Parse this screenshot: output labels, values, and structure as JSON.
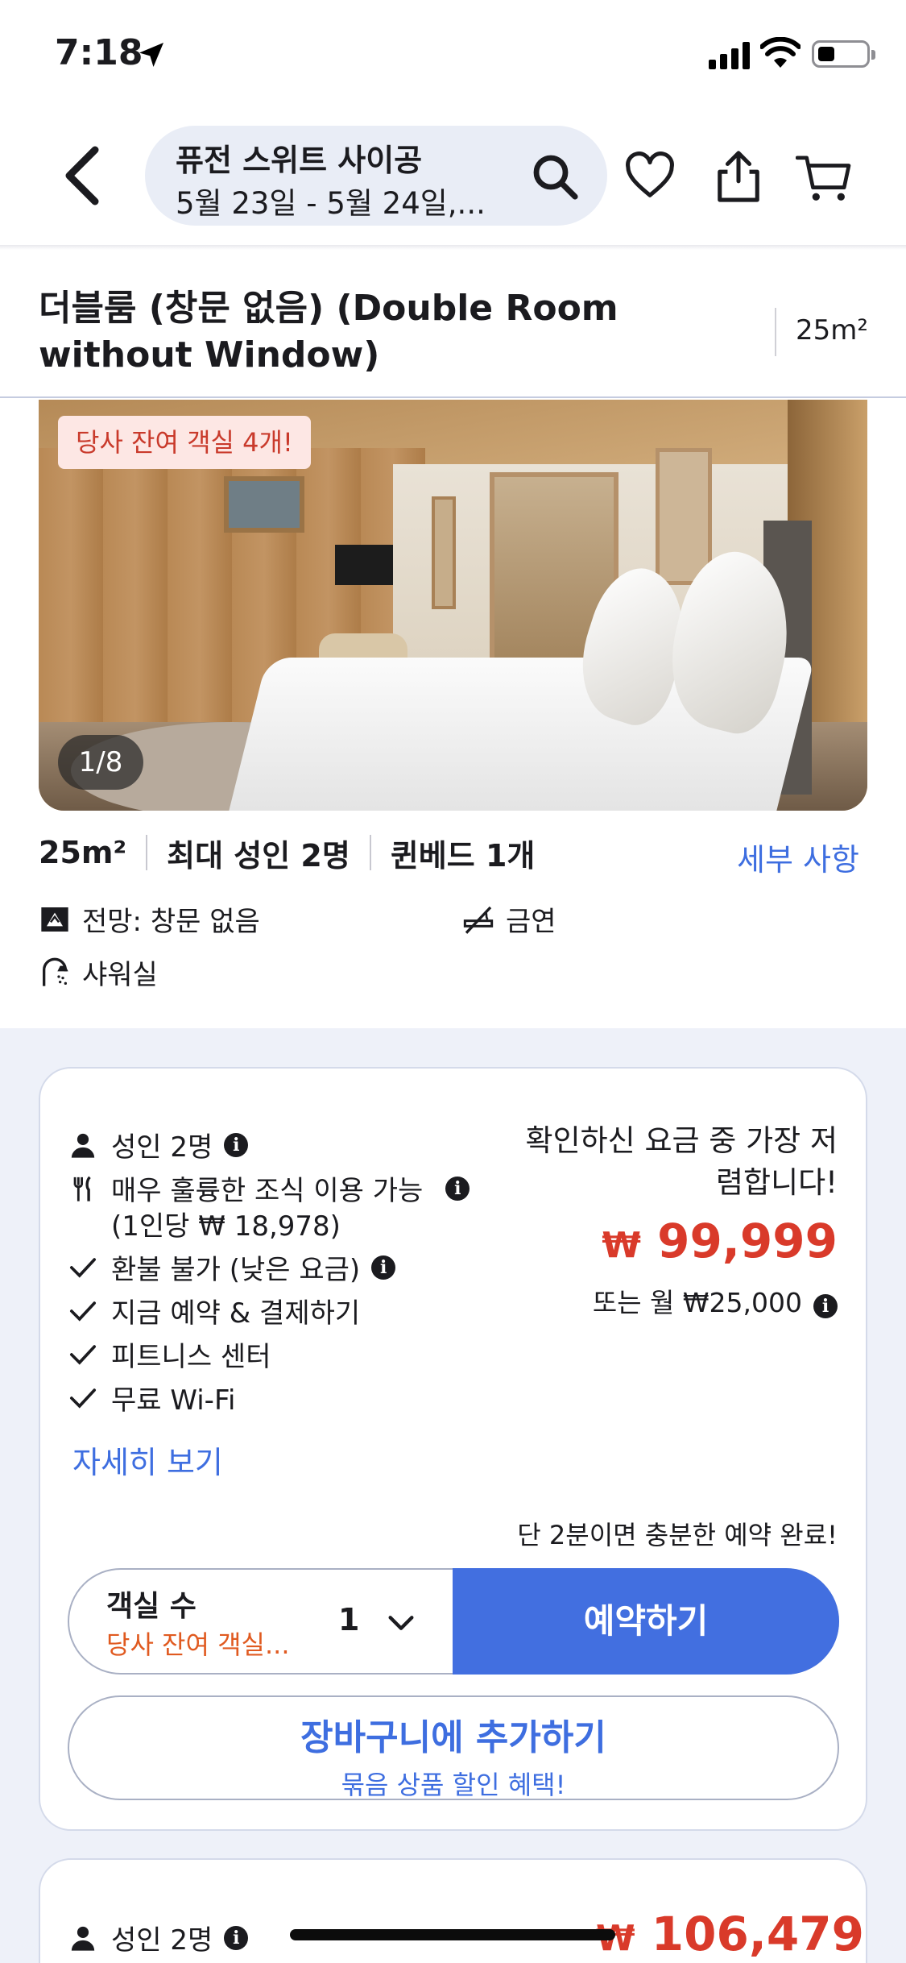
{
  "status_bar": {
    "time": "7:18"
  },
  "header": {
    "hotel_name": "퓨전 스위트 사이공",
    "dates": "5월 23일 - 5월 24일,..."
  },
  "room": {
    "title": "더블룸 (창문 없음) (Double Room without Window)",
    "size": "25m²",
    "scarcity_badge": "당사 잔여 객실 4개!",
    "photo_counter": "1/8",
    "facts": [
      "25m²",
      "최대 성인 2명",
      "퀸베드 1개"
    ],
    "details_link": "세부 사항",
    "amenities": {
      "view": "전망: 창문 없음",
      "smoking": "금연",
      "shower": "샤워실"
    }
  },
  "offer": {
    "guests": "성인 2명",
    "breakfast": "매우 훌륭한 조식 이용 가능",
    "breakfast_price": "(1인당 ₩ 18,978)",
    "refund": "환불 불가 (낮은 요금)",
    "pay_now": "지금 예약 & 결제하기",
    "fitness": "피트니스 센터",
    "wifi": "무료 Wi-Fi",
    "more_link": "자세히 보기",
    "price_note": "확인하신 요금 중 가장 저렴합니다!",
    "currency": "₩",
    "price": "99,999",
    "monthly": "또는 월 ₩25,000",
    "quick_note": "단 2분이면 충분한 예약 완료!",
    "room_count_label": "객실 수",
    "room_count_sub": "당사 잔여 객실...",
    "room_count_value": "1",
    "book_button": "예약하기",
    "cart_button": "장바구니에 추가하기",
    "cart_sub": "묶음 상품 할인 혜택!"
  },
  "offer2": {
    "guests": "성인 2명",
    "currency": "₩",
    "price": "106,479"
  },
  "colors": {
    "accent_blue": "#426fe0",
    "price_red": "#d93a2a",
    "badge_bg": "#fde7e4",
    "section_bg": "#eef1f9"
  },
  "icons": [
    "location-arrow-icon",
    "signal-icon",
    "wifi-icon",
    "battery-icon",
    "back-chevron-icon",
    "search-icon",
    "heart-icon",
    "share-icon",
    "cart-icon",
    "view-icon",
    "no-smoking-icon",
    "shower-icon",
    "person-icon",
    "fork-knife-icon",
    "checkmark-icon",
    "info-icon",
    "chevron-down-icon"
  ]
}
